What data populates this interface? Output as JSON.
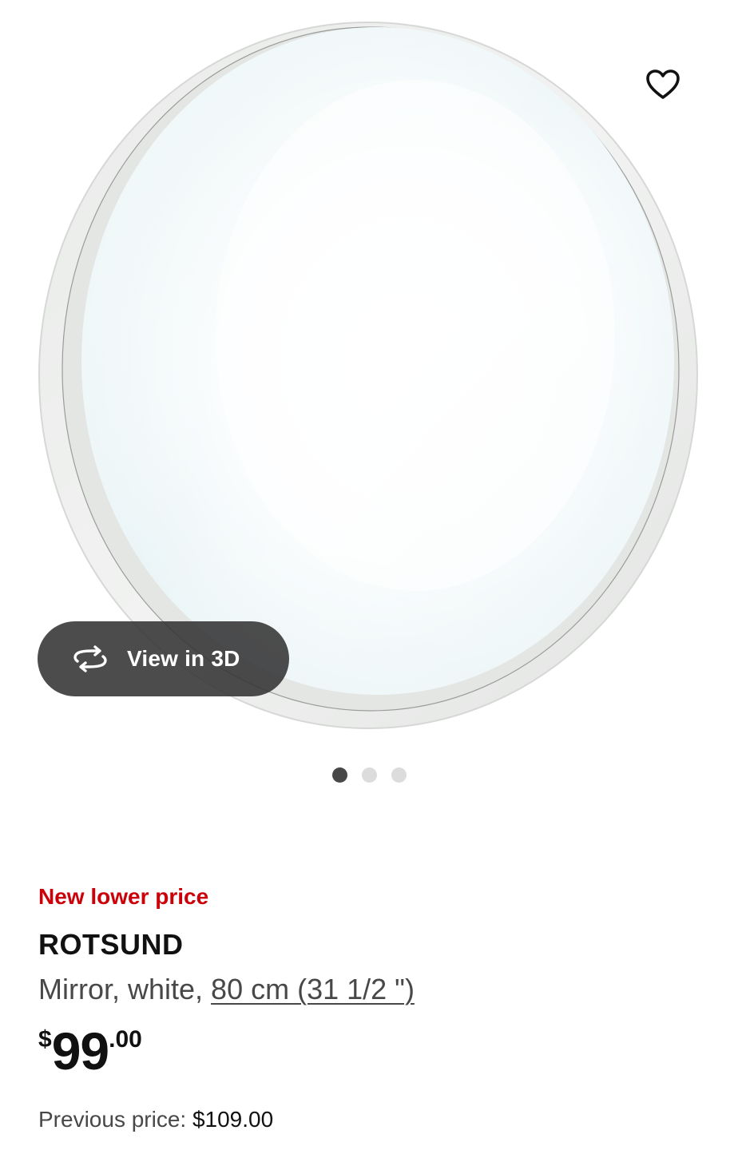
{
  "colors": {
    "badge_red": "#cc0008",
    "text_primary": "#111111",
    "text_secondary": "#484848",
    "view3d_bg": "#333333",
    "dot_active": "#484848",
    "dot_inactive": "#dcdcdc"
  },
  "gallery": {
    "favorite_icon": "heart-outline-icon",
    "view3d": {
      "icon": "rotate-3d-icon",
      "label": "View in 3D"
    },
    "dots": {
      "count": 3,
      "active_index": 0
    }
  },
  "product": {
    "badge": "New lower price",
    "name": "ROTSUND",
    "description_prefix": "Mirror, white, ",
    "size_link": "80 cm (31 1/2 \")",
    "price": {
      "currency": "$",
      "integer": "99",
      "decimal": ".00"
    },
    "previous_price_label": "Previous price: ",
    "previous_price_value": "$109.00"
  }
}
